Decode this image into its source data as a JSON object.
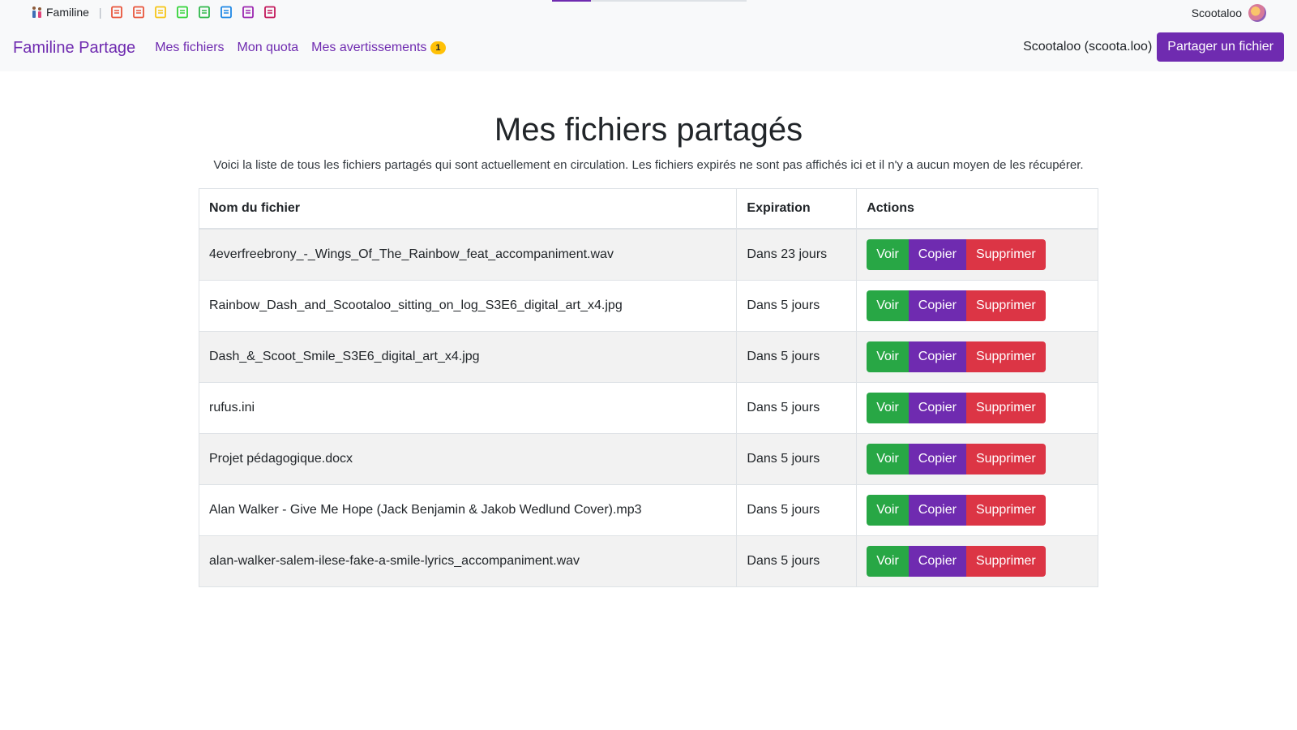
{
  "topbar": {
    "brand": "Familine",
    "user": "Scootaloo",
    "progress": 0.2,
    "app_icons": [
      "document-icon",
      "bookmark-icon",
      "book-icon",
      "atom-icon",
      "calendar-icon",
      "diagram-icon",
      "upload-icon",
      "contact-icon"
    ],
    "icon_colors": [
      "#e8553c",
      "#e8553c",
      "#f5c518",
      "#35d43a",
      "#2fb84b",
      "#1e88e5",
      "#9c27b0",
      "#c2185b"
    ]
  },
  "navbar": {
    "title": "Familine Partage",
    "links": [
      "Mes fichiers",
      "Mon quota",
      "Mes avertissements"
    ],
    "warnings_count": "1",
    "user_label": "Scootaloo (scoota.loo)",
    "share_button": "Partager un fichier"
  },
  "main": {
    "heading": "Mes fichiers partagés",
    "intro": "Voici la liste de tous les fichiers partagés qui sont actuellement en circulation. Les fichiers expirés ne sont pas affichés ici et il n'y a aucun moyen de les récupérer.",
    "columns": [
      "Nom du fichier",
      "Expiration",
      "Actions"
    ],
    "actions": {
      "view": "Voir",
      "copy": "Copier",
      "delete": "Supprimer"
    },
    "rows": [
      {
        "name": "4everfreebrony_-_Wings_Of_The_Rainbow_feat_accompaniment.wav",
        "expires": "Dans 23 jours"
      },
      {
        "name": "Rainbow_Dash_and_Scootaloo_sitting_on_log_S3E6_digital_art_x4.jpg",
        "expires": "Dans 5 jours"
      },
      {
        "name": "Dash_&_Scoot_Smile_S3E6_digital_art_x4.jpg",
        "expires": "Dans 5 jours"
      },
      {
        "name": "rufus.ini",
        "expires": "Dans 5 jours"
      },
      {
        "name": "Projet pédagogique.docx",
        "expires": "Dans 5 jours"
      },
      {
        "name": "Alan Walker - Give Me Hope (Jack Benjamin & Jakob Wedlund Cover).mp3",
        "expires": "Dans 5 jours"
      },
      {
        "name": "alan-walker-salem-ilese-fake-a-smile-lyrics_accompaniment.wav",
        "expires": "Dans 5 jours"
      }
    ]
  },
  "colors": {
    "primary": "#6f2bb0",
    "success": "#28a745",
    "danger": "#dc3545",
    "badge": "#ffc107"
  }
}
